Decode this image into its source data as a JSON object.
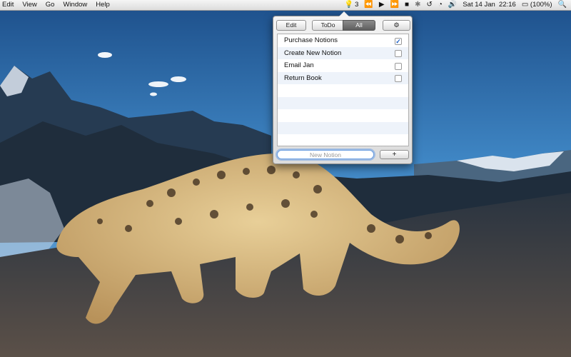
{
  "menubar": {
    "menus": [
      "Edit",
      "View",
      "Go",
      "Window",
      "Help"
    ],
    "status": {
      "app_icon": "lightbulb-icon",
      "app_count": "3",
      "media_icons": [
        "rewind-icon",
        "play-icon",
        "fast-forward-icon"
      ],
      "icons": [
        "bluetooth-icon",
        "time-machine-icon",
        "wifi-icon",
        "volume-icon"
      ],
      "datetime": "Sat 14 Jan  22:16",
      "battery": "(100%)",
      "search_icon": "spotlight-icon"
    }
  },
  "popover": {
    "toolbar": {
      "edit_label": "Edit",
      "todo_label": "ToDo",
      "all_label": "All",
      "selected_filter": "All",
      "gear_icon": "gear-icon"
    },
    "items": [
      {
        "label": "Purchase Notions",
        "checked": true
      },
      {
        "label": "Create New Notion",
        "checked": false
      },
      {
        "label": "Email Jan",
        "checked": false
      },
      {
        "label": "Return Book",
        "checked": false
      }
    ],
    "empty_rows": 5,
    "new_input": {
      "placeholder": "New Notion",
      "value": ""
    },
    "add_label": "+"
  },
  "colors": {
    "menubar_bg": "#e8e8e8",
    "accent": "#1f7be0",
    "selected_segment": "#6b6b6b",
    "row_stripe": "#eef3fa"
  }
}
